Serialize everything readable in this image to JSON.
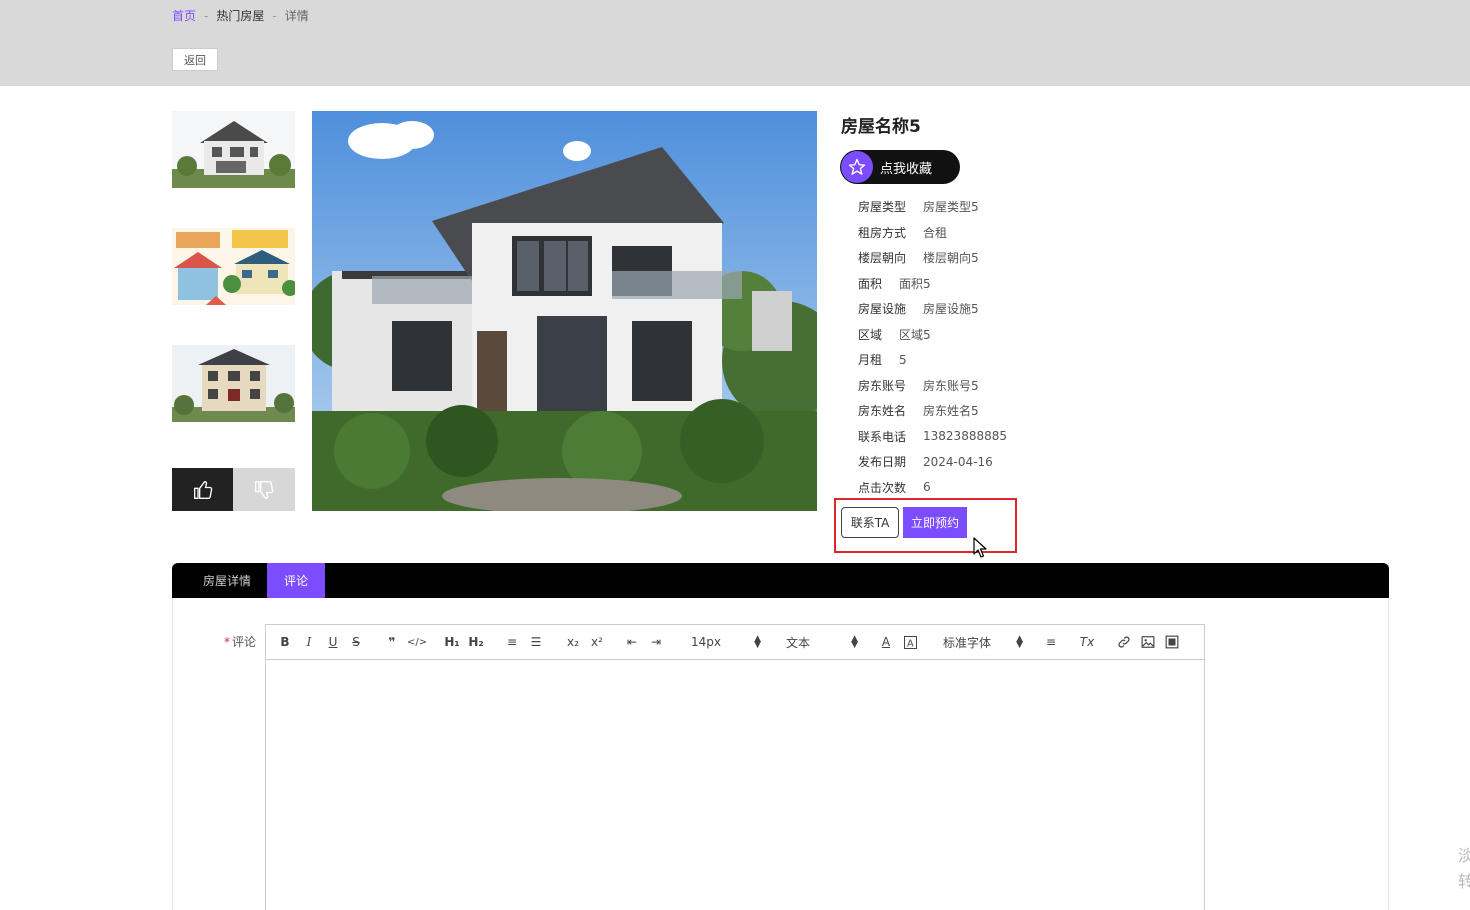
{
  "breadcrumb": {
    "home": "首页",
    "separator1": "-",
    "section": "热门房屋",
    "separator2": "-",
    "current": "详情"
  },
  "back_label": "返回",
  "house": {
    "title": "房屋名称5",
    "favorite_label": "点我收藏",
    "fields": [
      {
        "key": "房屋类型",
        "value": "房屋类型5"
      },
      {
        "key": "租房方式",
        "value": "合租"
      },
      {
        "key": "楼层朝向",
        "value": "楼层朝向5"
      },
      {
        "key": "面积",
        "value": "面积5"
      },
      {
        "key": "房屋设施",
        "value": "房屋设施5"
      },
      {
        "key": "区域",
        "value": "区域5"
      },
      {
        "key": "月租",
        "value": "5"
      },
      {
        "key": "房东账号",
        "value": "房东账号5"
      },
      {
        "key": "房东姓名",
        "value": "房东姓名5"
      },
      {
        "key": "联系电话",
        "value": "13823888885"
      },
      {
        "key": "发布日期",
        "value": "2024-04-16"
      },
      {
        "key": "点击次数",
        "value": "6"
      }
    ],
    "contact_label": "联系TA",
    "book_label": "立即预约"
  },
  "tabs": {
    "details": "房屋详情",
    "comment": "评论"
  },
  "comment": {
    "required_mark": "*",
    "label": "评论",
    "toolbar": {
      "bold": "B",
      "italic": "I",
      "underline": "U",
      "strike": "S",
      "blockquote": "❞",
      "code": "</>",
      "h1": "H₁",
      "h2": "H₂",
      "ordered_list": "≡",
      "bullet_list": "☰",
      "subscript": "x₂",
      "superscript": "x²",
      "indent_decrease": "⇤",
      "indent_increase": "⇥",
      "size": "14px",
      "header": "文本",
      "font": "标准字体",
      "align": "≡",
      "clean": "Tx",
      "link": "🔗",
      "image": "▣",
      "video": "▤"
    }
  },
  "colors": {
    "accent": "#7c4dff",
    "highlight": "#e0262d",
    "topbar": "#d9d9d9"
  },
  "watermark": "淡\n转"
}
